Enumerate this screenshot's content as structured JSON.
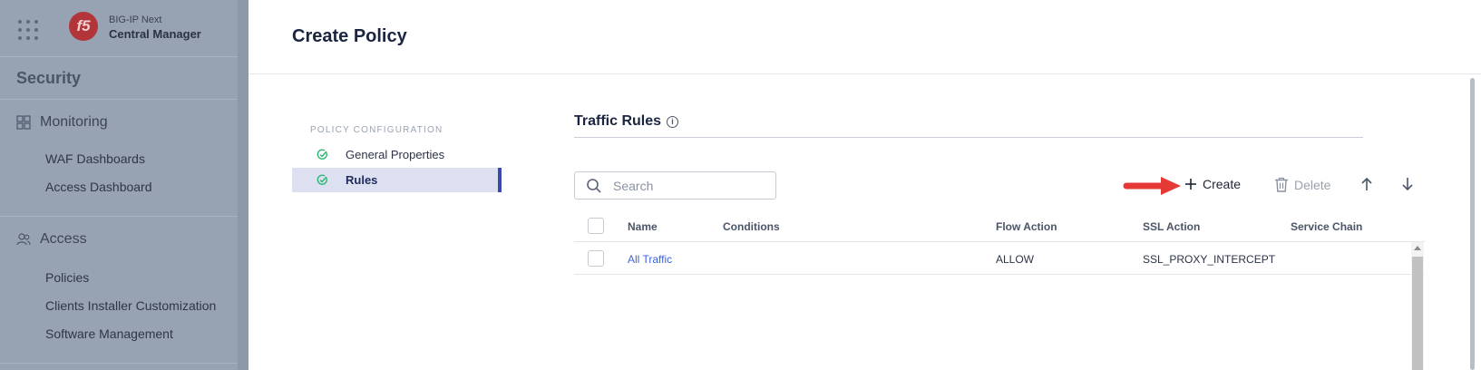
{
  "sidebar": {
    "brand_line1": "BIG-IP Next",
    "brand_line2": "Central Manager",
    "section_title": "Security",
    "groups": [
      {
        "label": "Monitoring",
        "icon": "dashboard-grid-icon",
        "items": [
          "WAF Dashboards",
          "Access Dashboard"
        ]
      },
      {
        "label": "Access",
        "icon": "users-icon",
        "items": [
          "Policies",
          "Clients Installer Customization",
          "Software Management"
        ]
      }
    ]
  },
  "header": {
    "title": "Create Policy"
  },
  "policy_nav": {
    "heading": "POLICY CONFIGURATION",
    "items": [
      {
        "label": "General Properties",
        "status": "complete"
      },
      {
        "label": "Rules",
        "status": "complete",
        "active": true
      }
    ]
  },
  "traffic_rules": {
    "title": "Traffic Rules",
    "search_placeholder": "Search",
    "toolbar": {
      "create_label": "Create",
      "delete_label": "Delete"
    },
    "columns": [
      "Name",
      "Conditions",
      "Flow Action",
      "SSL Action",
      "Service Chain"
    ],
    "rows": [
      {
        "name": "All Traffic",
        "conditions": "",
        "flow_action": "ALLOW",
        "ssl_action": "SSL_PROXY_INTERCEPT",
        "service_chain": ""
      }
    ]
  },
  "colors": {
    "accent": "#3a49ad",
    "link": "#3d63dd",
    "success": "#2bb673",
    "annotation_arrow": "#e53935"
  }
}
